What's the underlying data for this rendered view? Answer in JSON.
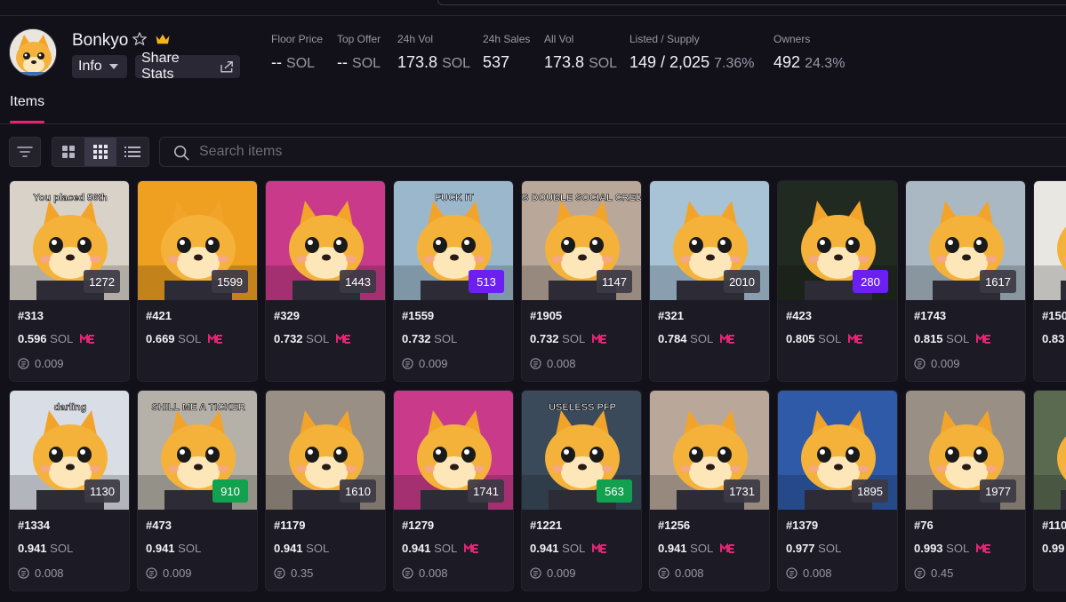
{
  "collection": {
    "name": "Bonkyo",
    "info_label": "Info",
    "share_label": "Share Stats"
  },
  "stats": [
    {
      "label": "Floor Price",
      "value": "--",
      "unit": "SOL",
      "extra": ""
    },
    {
      "label": "Top Offer",
      "value": "--",
      "unit": "SOL",
      "extra": ""
    },
    {
      "label": "24h Vol",
      "value": "173.8",
      "unit": "SOL",
      "extra": ""
    },
    {
      "label": "24h Sales",
      "value": "537",
      "unit": "",
      "extra": ""
    },
    {
      "label": "All Vol",
      "value": "173.8",
      "unit": "SOL",
      "extra": ""
    },
    {
      "label": "Listed / Supply",
      "value": "149 / 2,025",
      "unit": "",
      "extra": "7.36%"
    },
    {
      "label": "Owners",
      "value": "492",
      "unit": "",
      "extra": "24.3%"
    }
  ],
  "tabs": {
    "items_label": "Items"
  },
  "search": {
    "placeholder": "Search items"
  },
  "colors": {
    "accent": "#e42575",
    "badge_purple": "#6b1ff0",
    "badge_green": "#12a14f",
    "me_pink": "#e42575"
  },
  "cards": [
    {
      "id": "#313",
      "price": "0.596",
      "unit": "SOL",
      "me": true,
      "last": "0.009",
      "rank": "1272",
      "rank_color": "gray",
      "bg": "#d8d2c8",
      "caption": "You placed 56th"
    },
    {
      "id": "#421",
      "price": "0.669",
      "unit": "SOL",
      "me": true,
      "last": "",
      "rank": "1599",
      "rank_color": "gray",
      "bg": "#f0a020",
      "caption": ""
    },
    {
      "id": "#329",
      "price": "0.732",
      "unit": "SOL",
      "me": true,
      "last": "",
      "rank": "1443",
      "rank_color": "gray",
      "bg": "#c93b8a",
      "caption": ""
    },
    {
      "id": "#1559",
      "price": "0.732",
      "unit": "SOL",
      "me": false,
      "last": "0.009",
      "rank": "513",
      "rank_color": "purple",
      "bg": "#9bb7cc",
      "caption": "FUCK IT"
    },
    {
      "id": "#1905",
      "price": "0.732",
      "unit": "SOL",
      "me": true,
      "last": "0.008",
      "rank": "1147",
      "rank_color": "gray",
      "bg": "#b9a89a",
      "caption": "ITS DOUBLE SOCIAL CREDIT"
    },
    {
      "id": "#321",
      "price": "0.784",
      "unit": "SOL",
      "me": true,
      "last": "",
      "rank": "2010",
      "rank_color": "gray",
      "bg": "#a8c3d6",
      "caption": ""
    },
    {
      "id": "#423",
      "price": "0.805",
      "unit": "SOL",
      "me": true,
      "last": "",
      "rank": "280",
      "rank_color": "purple",
      "bg": "#202a20",
      "caption": ""
    },
    {
      "id": "#1743",
      "price": "0.815",
      "unit": "SOL",
      "me": true,
      "last": "0.009",
      "rank": "1617",
      "rank_color": "gray",
      "bg": "#a9b8c2",
      "caption": ""
    },
    {
      "id": "#150",
      "price": "0.83",
      "unit": "",
      "me": false,
      "last": "",
      "rank": "",
      "rank_color": "gray",
      "bg": "#e9e7e2",
      "caption": ""
    },
    {
      "id": "#1334",
      "price": "0.941",
      "unit": "SOL",
      "me": false,
      "last": "0.008",
      "rank": "1130",
      "rank_color": "gray",
      "bg": "#d9dde6",
      "caption": "darling"
    },
    {
      "id": "#473",
      "price": "0.941",
      "unit": "SOL",
      "me": false,
      "last": "0.009",
      "rank": "910",
      "rank_color": "green",
      "bg": "#b5b1a8",
      "caption": "SHILL ME A TICKER"
    },
    {
      "id": "#1179",
      "price": "0.941",
      "unit": "SOL",
      "me": false,
      "last": "0.35",
      "rank": "1610",
      "rank_color": "gray",
      "bg": "#9a8f84",
      "caption": ""
    },
    {
      "id": "#1279",
      "price": "0.941",
      "unit": "SOL",
      "me": true,
      "last": "0.008",
      "rank": "1741",
      "rank_color": "gray",
      "bg": "#c93b8a",
      "caption": ""
    },
    {
      "id": "#1221",
      "price": "0.941",
      "unit": "SOL",
      "me": true,
      "last": "0.009",
      "rank": "563",
      "rank_color": "green",
      "bg": "#3a4a5a",
      "caption": "USELESS PFP"
    },
    {
      "id": "#1256",
      "price": "0.941",
      "unit": "SOL",
      "me": true,
      "last": "0.008",
      "rank": "1731",
      "rank_color": "gray",
      "bg": "#b9a89a",
      "caption": ""
    },
    {
      "id": "#1379",
      "price": "0.977",
      "unit": "SOL",
      "me": false,
      "last": "0.008",
      "rank": "1895",
      "rank_color": "gray",
      "bg": "#2f5aa8",
      "caption": ""
    },
    {
      "id": "#76",
      "price": "0.993",
      "unit": "SOL",
      "me": true,
      "last": "0.45",
      "rank": "1977",
      "rank_color": "gray",
      "bg": "#9a8f84",
      "caption": ""
    },
    {
      "id": "#110",
      "price": "0.99",
      "unit": "",
      "me": false,
      "last": "",
      "rank": "",
      "rank_color": "gray",
      "bg": "#5a6a50",
      "caption": ""
    }
  ]
}
